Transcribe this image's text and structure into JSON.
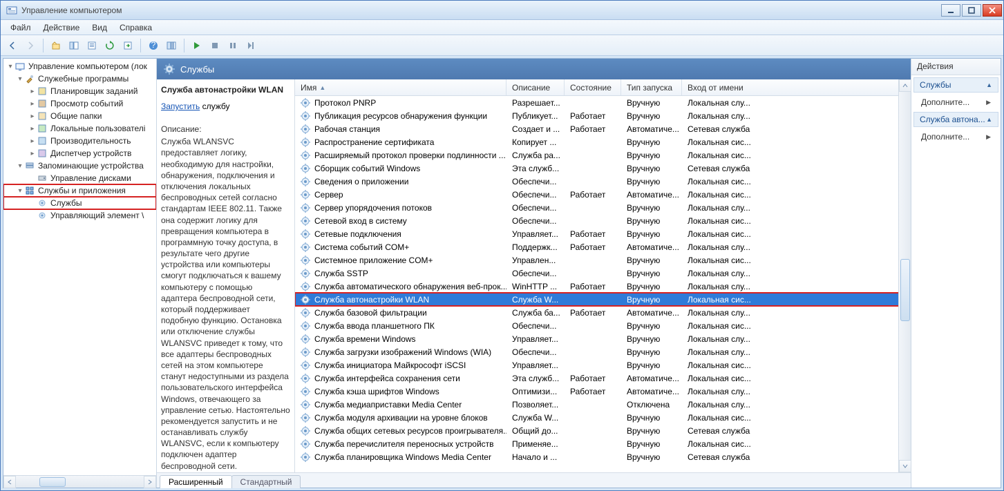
{
  "window": {
    "title": "Управление компьютером"
  },
  "menu": {
    "file": "Файл",
    "action": "Действие",
    "view": "Вид",
    "help": "Справка"
  },
  "tree": {
    "root": "Управление компьютером (лок",
    "group1": "Служебные программы",
    "g1_items": [
      "Планировщик заданий",
      "Просмотр событий",
      "Общие папки",
      "Локальные пользователі",
      "Производительность",
      "Диспетчер устройств"
    ],
    "group2": "Запоминающие устройства",
    "g2_items": [
      "Управление дисками"
    ],
    "group3": "Службы и приложения",
    "g3_items": [
      "Службы",
      "Управляющий элемент \\"
    ]
  },
  "header_title": "Службы",
  "detail": {
    "title": "Служба автонастройки WLAN",
    "start_link": "Запустить",
    "start_suffix": " службу",
    "desc_label": "Описание:",
    "desc_text": "Служба WLANSVC предоставляет логику, необходимую для настройки, обнаружения, подключения и отключения локальных беспроводных сетей согласно стандартам IEEE 802.11. Также она содержит логику для превращения компьютера в программную точку доступа, в результате чего другие устройства или компьютеры смогут подключаться к вашему компьютеру с помощью адаптера беспроводной сети, который поддерживает подобную функцию. Остановка или отключение службы WLANSVC приведет к тому, что все адаптеры беспроводных сетей на этом компьютере станут недоступными из раздела пользовательского интерфейса Windows, отвечающего за управление сетью. Настоятельно рекомендуется запустить и не останавливать службу WLANSVC, если к компьютеру подключен адаптер беспроводной сети."
  },
  "columns": {
    "name": "Имя",
    "desc": "Описание",
    "state": "Состояние",
    "start": "Тип запуска",
    "logon": "Вход от имени"
  },
  "services": [
    {
      "name": "Протокол PNRP",
      "desc": "Разрешает...",
      "state": "",
      "start": "Вручную",
      "logon": "Локальная слу..."
    },
    {
      "name": "Публикация ресурсов обнаружения функции",
      "desc": "Публикует...",
      "state": "Работает",
      "start": "Вручную",
      "logon": "Локальная слу..."
    },
    {
      "name": "Рабочая станция",
      "desc": "Создает и ...",
      "state": "Работает",
      "start": "Автоматиче...",
      "logon": "Сетевая служба"
    },
    {
      "name": "Распространение сертификата",
      "desc": "Копирует ...",
      "state": "",
      "start": "Вручную",
      "logon": "Локальная сис..."
    },
    {
      "name": "Расширяемый протокол проверки подлинности ...",
      "desc": "Служба ра...",
      "state": "",
      "start": "Вручную",
      "logon": "Локальная сис..."
    },
    {
      "name": "Сборщик событий Windows",
      "desc": "Эта служб...",
      "state": "",
      "start": "Вручную",
      "logon": "Сетевая служба"
    },
    {
      "name": "Сведения о приложении",
      "desc": "Обеспечи...",
      "state": "",
      "start": "Вручную",
      "logon": "Локальная сис..."
    },
    {
      "name": "Сервер",
      "desc": "Обеспечи...",
      "state": "Работает",
      "start": "Автоматиче...",
      "logon": "Локальная сис..."
    },
    {
      "name": "Сервер упорядочения потоков",
      "desc": "Обеспечи...",
      "state": "",
      "start": "Вручную",
      "logon": "Локальная слу..."
    },
    {
      "name": "Сетевой вход в систему",
      "desc": "Обеспечи...",
      "state": "",
      "start": "Вручную",
      "logon": "Локальная сис..."
    },
    {
      "name": "Сетевые подключения",
      "desc": "Управляет...",
      "state": "Работает",
      "start": "Вручную",
      "logon": "Локальная сис..."
    },
    {
      "name": "Система событий COM+",
      "desc": "Поддержк...",
      "state": "Работает",
      "start": "Автоматиче...",
      "logon": "Локальная слу..."
    },
    {
      "name": "Системное приложение COM+",
      "desc": "Управлен...",
      "state": "",
      "start": "Вручную",
      "logon": "Локальная сис..."
    },
    {
      "name": "Служба SSTP",
      "desc": "Обеспечи...",
      "state": "",
      "start": "Вручную",
      "logon": "Локальная слу..."
    },
    {
      "name": "Служба автоматического обнаружения веб-прок...",
      "desc": "WinHTTP ...",
      "state": "Работает",
      "start": "Вручную",
      "logon": "Локальная слу..."
    },
    {
      "name": "Служба автонастройки WLAN",
      "desc": "Служба W...",
      "state": "",
      "start": "Вручную",
      "logon": "Локальная сис...",
      "selected": true
    },
    {
      "name": "Служба базовой фильтрации",
      "desc": "Служба ба...",
      "state": "Работает",
      "start": "Автоматиче...",
      "logon": "Локальная слу..."
    },
    {
      "name": "Служба ввода планшетного ПК",
      "desc": "Обеспечи...",
      "state": "",
      "start": "Вручную",
      "logon": "Локальная сис..."
    },
    {
      "name": "Служба времени Windows",
      "desc": "Управляет...",
      "state": "",
      "start": "Вручную",
      "logon": "Локальная слу..."
    },
    {
      "name": "Служба загрузки изображений Windows (WIA)",
      "desc": "Обеспечи...",
      "state": "",
      "start": "Вручную",
      "logon": "Локальная слу..."
    },
    {
      "name": "Служба инициатора Майкрософт iSCSI",
      "desc": "Управляет...",
      "state": "",
      "start": "Вручную",
      "logon": "Локальная сис..."
    },
    {
      "name": "Служба интерфейса сохранения сети",
      "desc": "Эта служб...",
      "state": "Работает",
      "start": "Автоматиче...",
      "logon": "Локальная сис..."
    },
    {
      "name": "Служба кэша шрифтов Windows",
      "desc": "Оптимизи...",
      "state": "Работает",
      "start": "Автоматиче...",
      "logon": "Локальная слу..."
    },
    {
      "name": "Служба медиаприставки Media Center",
      "desc": "Позволяет...",
      "state": "",
      "start": "Отключена",
      "logon": "Локальная слу..."
    },
    {
      "name": "Служба модуля архивации на уровне блоков",
      "desc": "Служба W...",
      "state": "",
      "start": "Вручную",
      "logon": "Локальная сис..."
    },
    {
      "name": "Служба общих сетевых ресурсов проигрывателя...",
      "desc": "Общий до...",
      "state": "",
      "start": "Вручную",
      "logon": "Сетевая служба"
    },
    {
      "name": "Служба перечислителя переносных устройств",
      "desc": "Применяе...",
      "state": "",
      "start": "Вручную",
      "logon": "Локальная сис..."
    },
    {
      "name": "Служба планировщика Windows Media Center",
      "desc": "Начало и ...",
      "state": "",
      "start": "Вручную",
      "logon": "Сетевая служба"
    }
  ],
  "tabs": {
    "extended": "Расширенный",
    "standard": "Стандартный"
  },
  "actions": {
    "title": "Действия",
    "section1": "Службы",
    "section2": "Служба автона...",
    "more": "Дополните..."
  }
}
